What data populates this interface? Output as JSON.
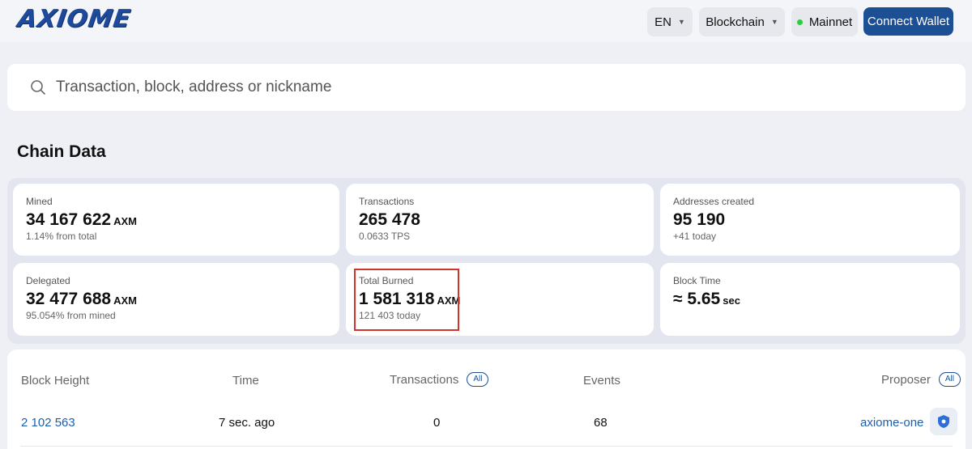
{
  "header": {
    "logo": "AXIOME",
    "language": "EN",
    "blockchain_menu": "Blockchain",
    "network": "Mainnet",
    "connect_wallet": "Connect Wallet"
  },
  "search": {
    "placeholder": "Transaction, block, address or nickname"
  },
  "chain_data": {
    "title": "Chain Data",
    "cards": [
      {
        "label": "Mined",
        "value": "34 167 622",
        "unit": "AXM",
        "sub": "1.14% from total"
      },
      {
        "label": "Transactions",
        "value": "265 478",
        "unit": "",
        "sub": "0.0633 TPS"
      },
      {
        "label": "Addresses created",
        "value": "95 190",
        "unit": "",
        "sub": "+41 today"
      },
      {
        "label": "Delegated",
        "value": "32 477 688",
        "unit": "AXM",
        "sub": "95.054% from mined"
      },
      {
        "label": "Total Burned",
        "value": "1 581 318",
        "unit": "AXM",
        "sub": "121 403 today"
      },
      {
        "label": "Block Time",
        "value": "≈ 5.65",
        "unit": "sec",
        "sub": ""
      }
    ]
  },
  "blocks_table": {
    "headers": {
      "block_height": "Block Height",
      "time": "Time",
      "transactions": "Transactions",
      "transactions_filter": "All",
      "events": "Events",
      "proposer": "Proposer",
      "proposer_filter": "All"
    },
    "rows": [
      {
        "block_height": "2 102 563",
        "time": "7 sec. ago",
        "transactions": "0",
        "events": "68",
        "proposer": "axiome-one"
      }
    ]
  },
  "colors": {
    "accent": "#1c4f93",
    "link": "#1c5fb0",
    "highlight_border": "#d0342c",
    "status_online": "#2ecc40"
  }
}
